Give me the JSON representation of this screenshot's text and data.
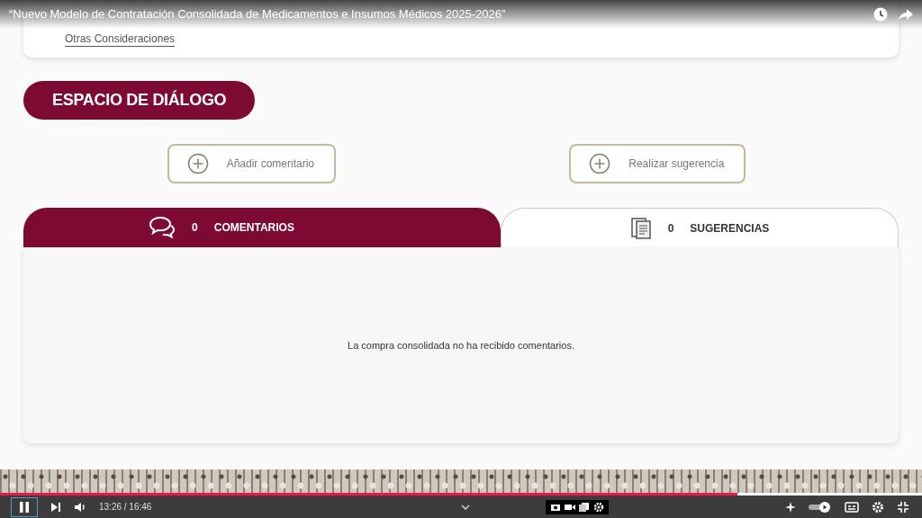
{
  "video": {
    "title": "“Nuevo Modelo de Contratación Consolidada de Medicamentos e Insumos Médicos 2025-2026”"
  },
  "page": {
    "previous_section_link": "Otras Consideraciones",
    "heading": "ESPACIO DE DIÁLOGO",
    "actions": [
      {
        "label": "Añadir comentario"
      },
      {
        "label": "Realizar sugerencia"
      }
    ],
    "tabs": [
      {
        "kind": "comments",
        "count": "0",
        "label": "COMENTARIOS",
        "selected": true
      },
      {
        "kind": "suggestions",
        "count": "0",
        "label": "SUGERENCIAS",
        "selected": false
      }
    ],
    "empty_message": "La compra consolidada no ha recibido comentarios."
  },
  "player": {
    "playing": true,
    "progress": {
      "level": 0.8
    },
    "time": "13:26 / 16:46"
  }
}
